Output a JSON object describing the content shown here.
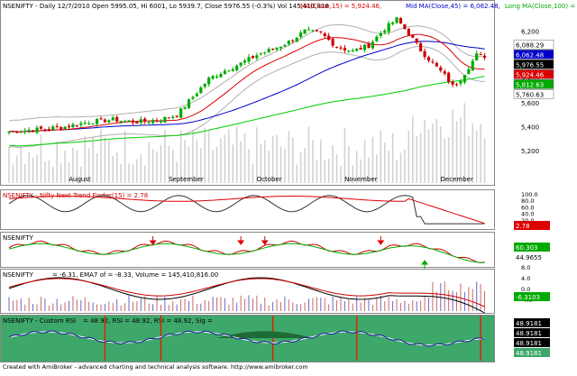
{
  "chart_data": [
    {
      "panel": "price",
      "type": "candlestick",
      "header": {
        "symbol": "NSENIFTY - Daily 12/7/2010",
        "ohlc": "Open 5995.05, Hi 6001, Lo 5939.7, Close 5976.55 (-0.3%) Vol 145,410,816",
        "ma15": "MA(Close,15) = 5,924.46,",
        "ma45": "Mid MA(Close,45) = 6,062.48,",
        "ma100": "Long MA(Close,100) = 5,7"
      },
      "ylim": [
        5080,
        6400
      ],
      "y_ticks": [
        5200,
        5400,
        5600,
        5800,
        6000,
        6200
      ],
      "x_labels": [
        "August",
        "September",
        "October",
        "November",
        "December"
      ],
      "x_label_index": [
        19,
        44,
        66,
        88,
        112
      ],
      "num_bars": 120,
      "anchors": [
        [
          0,
          5360
        ],
        [
          8,
          5380
        ],
        [
          14,
          5400
        ],
        [
          20,
          5440
        ],
        [
          26,
          5460
        ],
        [
          32,
          5440
        ],
        [
          38,
          5460
        ],
        [
          42,
          5500
        ],
        [
          46,
          5650
        ],
        [
          50,
          5800
        ],
        [
          54,
          5870
        ],
        [
          58,
          5930
        ],
        [
          62,
          6000
        ],
        [
          66,
          6050
        ],
        [
          70,
          6110
        ],
        [
          74,
          6200
        ],
        [
          78,
          6180
        ],
        [
          82,
          6070
        ],
        [
          86,
          6030
        ],
        [
          90,
          6080
        ],
        [
          94,
          6220
        ],
        [
          97,
          6300
        ],
        [
          100,
          6180
        ],
        [
          103,
          6040
        ],
        [
          106,
          5930
        ],
        [
          109,
          5830
        ],
        [
          111,
          5740
        ],
        [
          113,
          5800
        ],
        [
          115,
          5900
        ],
        [
          117,
          6000
        ],
        [
          119,
          5977
        ]
      ],
      "price_labels": [
        {
          "text": "6,088.29",
          "value": 6088,
          "bg": "#ffffff",
          "fg": "#000000"
        },
        {
          "text": "6,062.48",
          "value": 6062,
          "bg": "#0000cc",
          "fg": "#ffffff"
        },
        {
          "text": "5,976.55",
          "value": 5977,
          "bg": "#000000",
          "fg": "#ffffff"
        },
        {
          "text": "5,924.46",
          "value": 5924,
          "bg": "#dd0000",
          "fg": "#ffffff"
        },
        {
          "text": "5,812.63",
          "value": 5813,
          "bg": "#00aa00",
          "fg": "#ffffff"
        },
        {
          "text": "5,760.63",
          "value": 5761,
          "bg": "#ffffff",
          "fg": "#000000"
        }
      ],
      "colors": {
        "up": "#00aa00",
        "down": "#cc0000",
        "ma15": "#dd0000",
        "ma45": "#0000cc",
        "ma100": "#00cc00",
        "band": "#b0b0b0",
        "volume": "#d0d0d0"
      }
    },
    {
      "panel": "trend",
      "type": "line",
      "title": "NSENIFTY - Nifty Next Trend Finder(15) = 2.78",
      "y_ticks": [
        "100.0",
        "80.0",
        "60.0",
        "40.0",
        "20.0",
        "0.0"
      ],
      "ylim": [
        0,
        100
      ],
      "value_label": "2.78"
    },
    {
      "panel": "oscillator",
      "type": "line",
      "title": "NSENIFTY",
      "value_labels": [
        "60.303",
        "44.9655"
      ],
      "down_arrows_at": [
        36,
        58,
        64,
        93
      ],
      "up_arrow_at": 104
    },
    {
      "panel": "macd",
      "type": "line",
      "title": "NSENIFTY",
      "legend_text": "= -6.31, EMA7 of  = -8.33, Volume = 145,410,816.00",
      "y_ticks": [
        "8.0",
        "4.0",
        "0.0",
        "-4.0"
      ],
      "value_label": "-6.3103"
    },
    {
      "panel": "rsi",
      "type": "line",
      "title": "NSENIFTY - Custom RSI",
      "legend_text": "= 48.92, RSI = 48.92, RSI  = 48.92,  Sig =",
      "value_labels": [
        "48.9181",
        "48.9181",
        "48.9181",
        "48.9181"
      ],
      "vertical_markers_at": [
        24,
        38,
        66,
        87,
        118
      ]
    }
  ],
  "footer": "Created with AmiBroker - advanced charting and technical analysis software. http://www.amibroker.com"
}
